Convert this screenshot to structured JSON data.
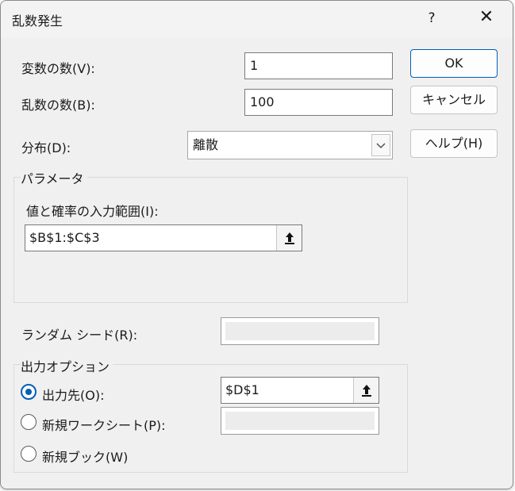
{
  "dialog": {
    "title": "乱数発生",
    "help_glyph": "?",
    "close_glyph": "✕"
  },
  "fields": {
    "num_variables": {
      "label": "変数の数(V):",
      "value": "1"
    },
    "num_random": {
      "label": "乱数の数(B):",
      "value": "100"
    },
    "distribution": {
      "label": "分布(D):",
      "selected": "離散"
    }
  },
  "buttons": {
    "ok": "OK",
    "cancel": "キャンセル",
    "help": "ヘルプ(H)"
  },
  "parameters": {
    "group_title": "パラメータ",
    "range_label": "値と確率の入力範囲(I):",
    "range_value": "$B$1:$C$3"
  },
  "seed": {
    "label": "ランダム シード(R):",
    "value": ""
  },
  "output": {
    "group_title": "出力オプション",
    "options": [
      {
        "label": "出力先(O):",
        "selected": true,
        "value": "$D$1"
      },
      {
        "label": "新規ワークシート(P):",
        "selected": false,
        "value": ""
      },
      {
        "label": "新規ブック(W)",
        "selected": false
      }
    ]
  }
}
